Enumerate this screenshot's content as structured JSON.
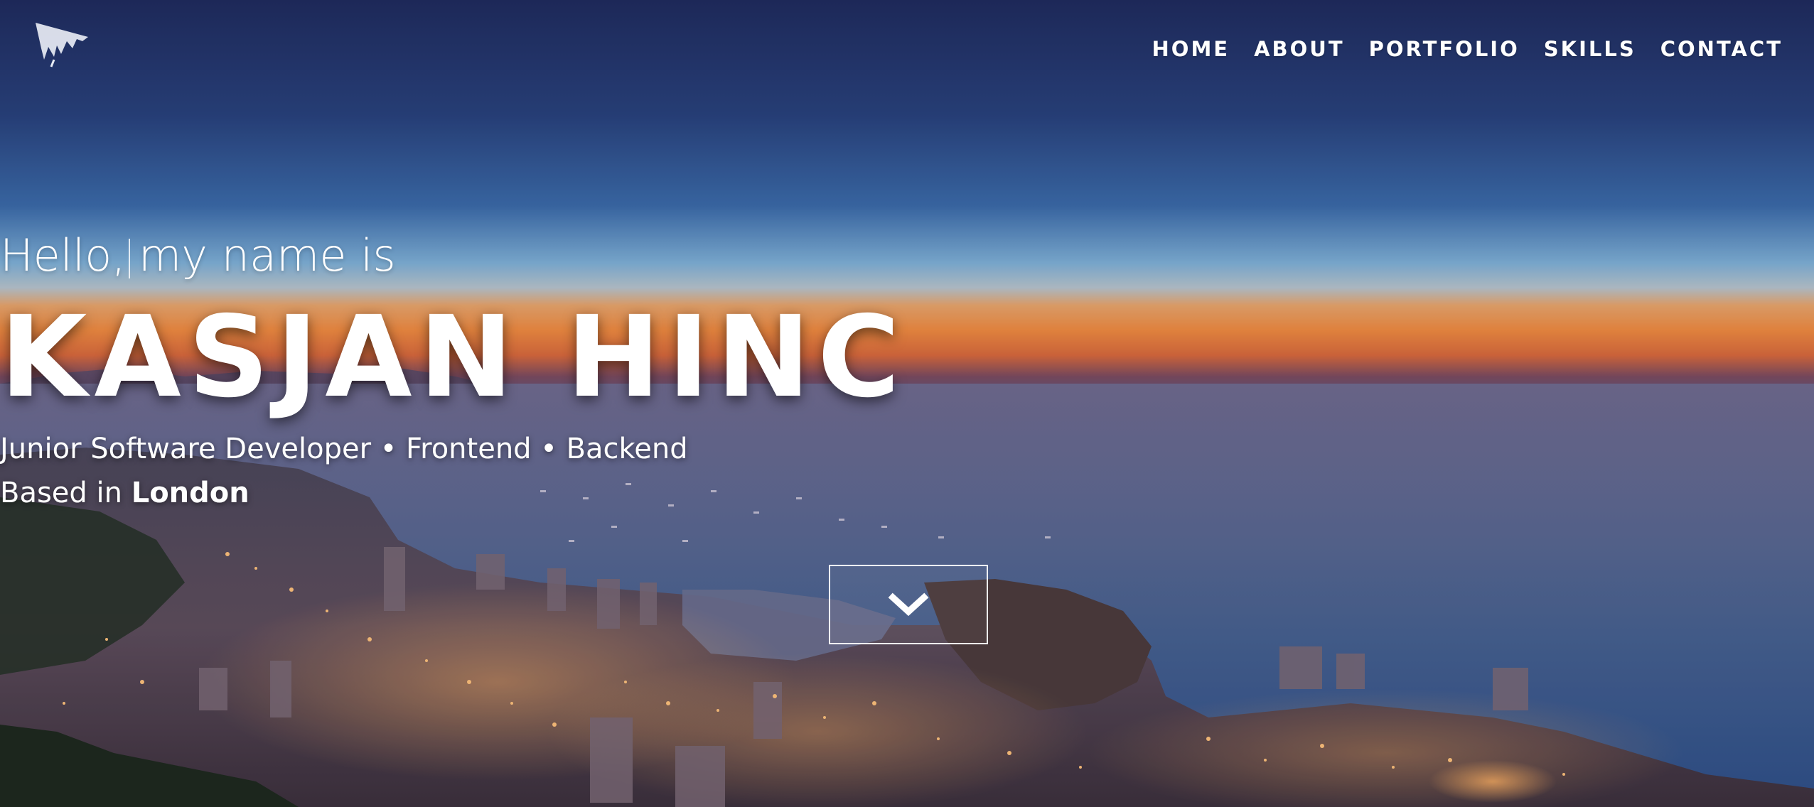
{
  "nav": {
    "logo_icon": "brand-logo-icon",
    "items": [
      {
        "label": "HOME"
      },
      {
        "label": "ABOUT"
      },
      {
        "label": "PORTFOLIO"
      },
      {
        "label": "SKILLS"
      },
      {
        "label": "CONTACT"
      }
    ]
  },
  "hero": {
    "greeting_part1": "Hello,",
    "greeting_part2": "my name is",
    "name": "KASJAN HINC",
    "role": "Junior Software Developer • Frontend • Backend",
    "location_prefix": "Based in",
    "location_city": "London",
    "scroll_icon": "chevron-down-icon"
  },
  "colors": {
    "text": "#ffffff",
    "sky_top": "#1e2a5c",
    "sunset": "#f08a3e",
    "sea": "#45608f"
  }
}
